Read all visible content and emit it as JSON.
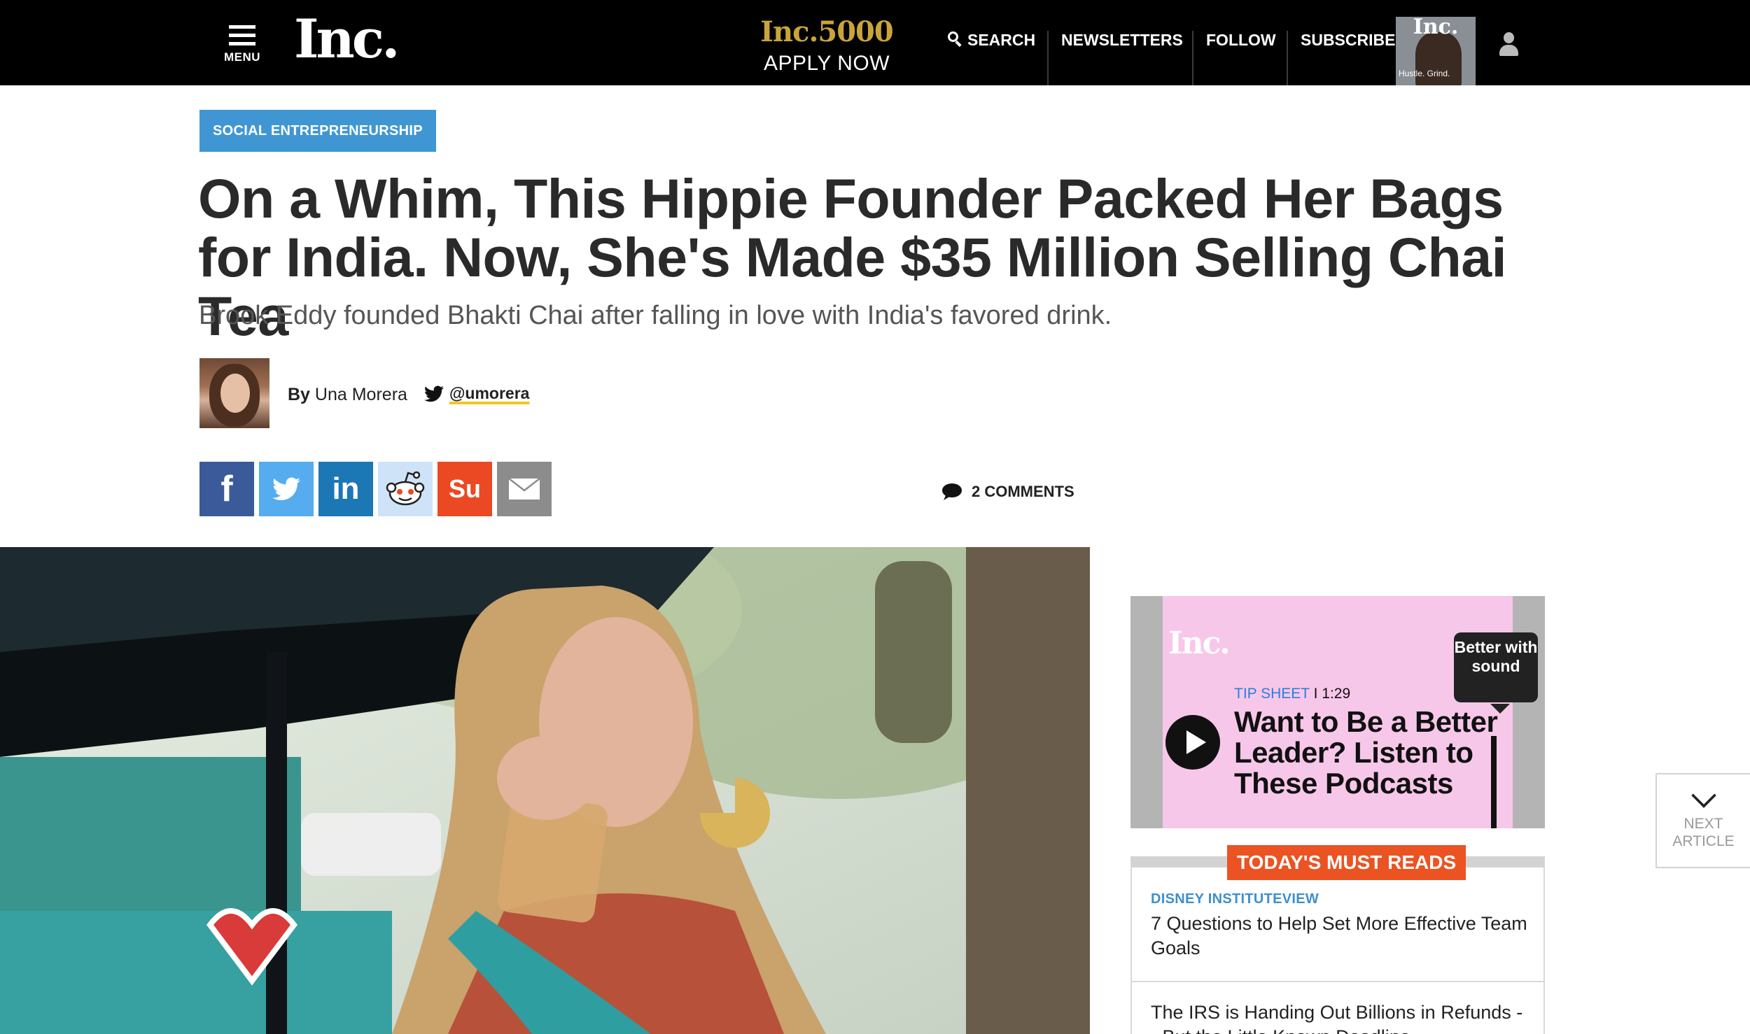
{
  "header": {
    "menu_label": "MENU",
    "logo_text": "Inc.",
    "promo": {
      "title": "Inc.5000",
      "cta": "APPLY NOW"
    },
    "nav": {
      "search": "SEARCH",
      "newsletters": "NEWSLETTERS",
      "follow": "FOLLOW",
      "subscribe": "SUBSCRIBE"
    },
    "magazine": {
      "masthead": "Inc.",
      "cover_line": "Hustle. Grind."
    }
  },
  "article": {
    "category": "SOCIAL ENTREPRENEURSHIP",
    "headline": "On a Whim, This Hippie Founder Packed Her Bags for India. Now, She's Made $35 Million Selling Chai Tea",
    "dek": "Brook Eddy founded Bhakti Chai after falling in love with India's favored drink.",
    "byline_prefix": "By",
    "author": "Una Morera",
    "twitter_handle": "@umorera",
    "comments": "2 COMMENTS",
    "share": [
      "facebook-icon",
      "twitter-icon",
      "linkedin-icon",
      "reddit-icon",
      "stumbleupon-icon",
      "email-icon"
    ]
  },
  "sidebar": {
    "video": {
      "logo": "Inc.",
      "sound_badge": "Better with sound",
      "category": "TIP SHEET",
      "separator": "I",
      "duration": "1:29",
      "title": "Want to Be a Better Leader? Listen to These Podcasts"
    },
    "must_reads": {
      "title": "TODAY'S MUST READS",
      "items": [
        {
          "kicker": "DISNEY INSTITUTEVIEW",
          "title": "7 Questions to Help Set More Effective Team Goals"
        },
        {
          "kicker": "",
          "title": "The IRS is Handing Out Billions in Refunds -- But the Little Known Deadline"
        }
      ]
    }
  },
  "next_article": {
    "line1": "NEXT",
    "line2": "ARTICLE"
  },
  "colors": {
    "header_bg": "#000000",
    "category": "#4096d3",
    "must_reads": "#eb5322",
    "promo_gold": "#c9a43a",
    "video_pink": "#f7c7ea"
  }
}
